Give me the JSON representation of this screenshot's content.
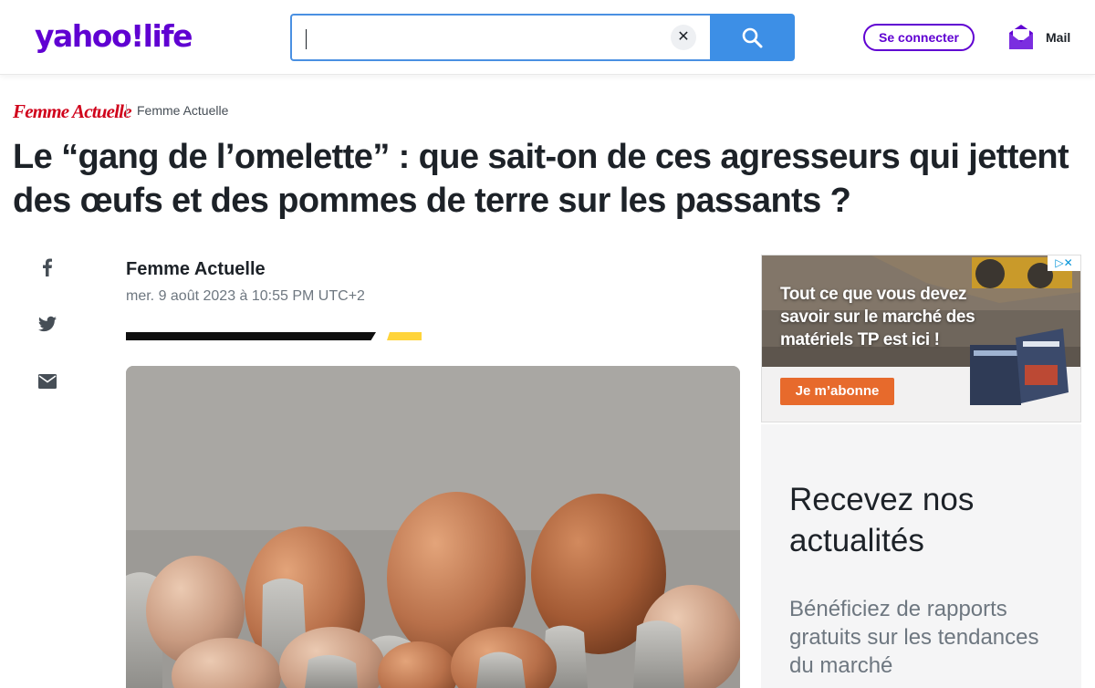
{
  "header": {
    "logo": "yahoo!life",
    "search_value": "",
    "search_clear_label": "✕",
    "login_label": "Se connecter",
    "mail_label": "Mail"
  },
  "article": {
    "source_logo": "Femme Actuelle",
    "source_name": "Femme Actuelle",
    "headline": "Le “gang de l’omelette” : que sait-on de ces agresseurs qui jettent des œufs et des pommes de terre sur les passants ?",
    "author": "Femme Actuelle",
    "date": "mer. 9 août 2023 à 10:55 PM UTC+2"
  },
  "share": {
    "items": [
      "facebook-icon",
      "twitter-icon",
      "mail-icon"
    ]
  },
  "ad": {
    "text": "Tout ce que vous devez savoir sur le marché des matériels TP est ici !",
    "cta": "Je m’abonne",
    "choices": "▷✕"
  },
  "panel": {
    "title": "Recevez nos actualités",
    "body": "Bénéficiez de rapports gratuits sur les tendances du marché"
  },
  "colors": {
    "brand_purple": "#6001d2",
    "search_blue": "#3d8fe6",
    "source_red": "#d0021b",
    "accent_yellow": "#ffd43a",
    "ad_cta_orange": "#e76a2c"
  }
}
